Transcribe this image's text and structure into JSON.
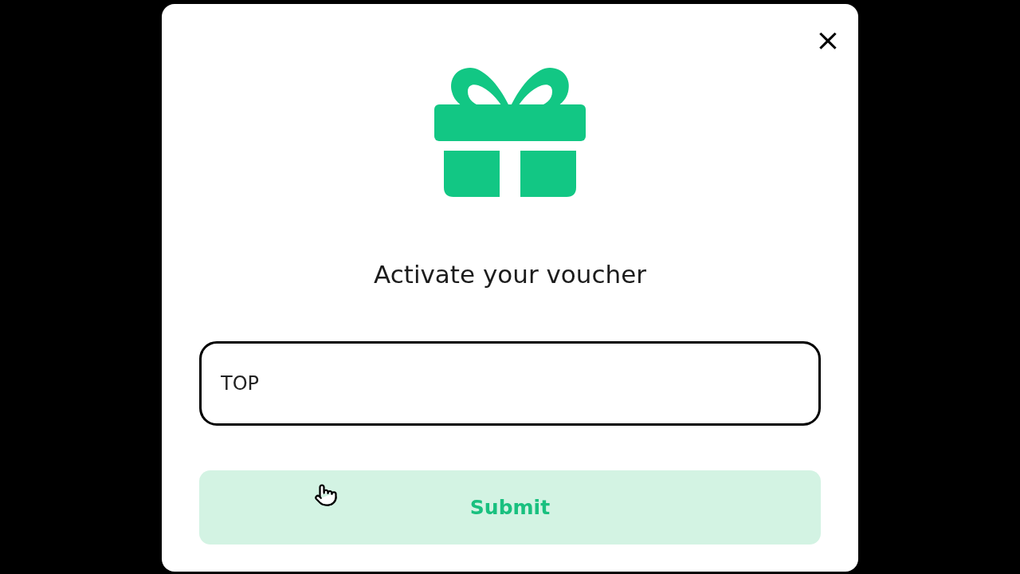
{
  "dialog": {
    "title": "Activate your voucher",
    "close": "×"
  },
  "voucher_field": {
    "value": "TOP"
  },
  "submit_button": {
    "label": "Submit",
    "disabled": true
  }
}
